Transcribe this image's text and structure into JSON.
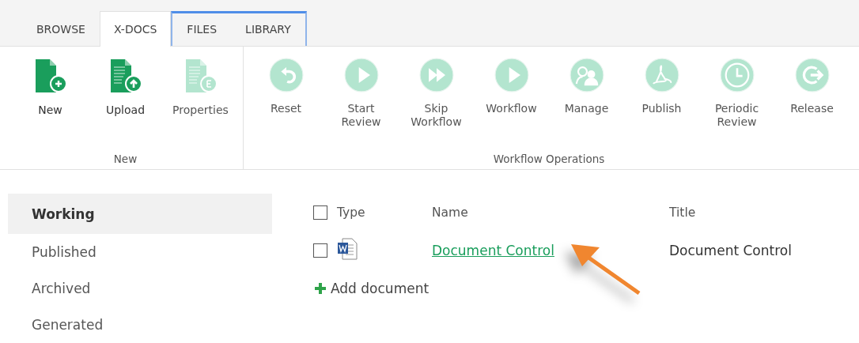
{
  "tabs": [
    {
      "label": "BROWSE",
      "selected": false,
      "kind": "plain"
    },
    {
      "label": "X-DOCS",
      "selected": true,
      "kind": "plain"
    },
    {
      "label": "FILES",
      "selected": false,
      "kind": "contextual"
    },
    {
      "label": "LIBRARY",
      "selected": false,
      "kind": "contextual"
    }
  ],
  "ribbon": {
    "groups": [
      {
        "label": "New",
        "buttons": [
          {
            "label": "New",
            "kind": "new-doc",
            "disabled": false
          },
          {
            "label": "Upload",
            "kind": "upload-doc",
            "disabled": false
          },
          {
            "label": "Properties",
            "kind": "props-doc",
            "disabled": true
          }
        ]
      },
      {
        "label": "Workflow Operations",
        "buttons": [
          {
            "label": "Reset",
            "kind": "undo",
            "disabled": true
          },
          {
            "label": "Start Review",
            "kind": "play",
            "disabled": true
          },
          {
            "label": "Skip Workflow",
            "kind": "forward",
            "disabled": true
          },
          {
            "label": "Workflow",
            "kind": "play",
            "disabled": true
          },
          {
            "label": "Manage",
            "kind": "people",
            "disabled": true
          },
          {
            "label": "Publish",
            "kind": "pdf",
            "disabled": true
          },
          {
            "label": "Periodic Review",
            "kind": "clock",
            "disabled": true
          },
          {
            "label": "Release",
            "kind": "exit",
            "disabled": true
          }
        ]
      }
    ]
  },
  "sidebar": {
    "items": [
      {
        "label": "Working",
        "selected": true
      },
      {
        "label": "Published",
        "selected": false
      },
      {
        "label": "Archived",
        "selected": false
      },
      {
        "label": "Generated",
        "selected": false
      }
    ]
  },
  "table": {
    "select_all": {
      "checked": false
    },
    "columns": [
      "Type",
      "Name",
      "Title"
    ],
    "rows": [
      {
        "checked": false,
        "name": "Document Control",
        "title": "Document Control"
      }
    ]
  },
  "add_link": "Add document"
}
